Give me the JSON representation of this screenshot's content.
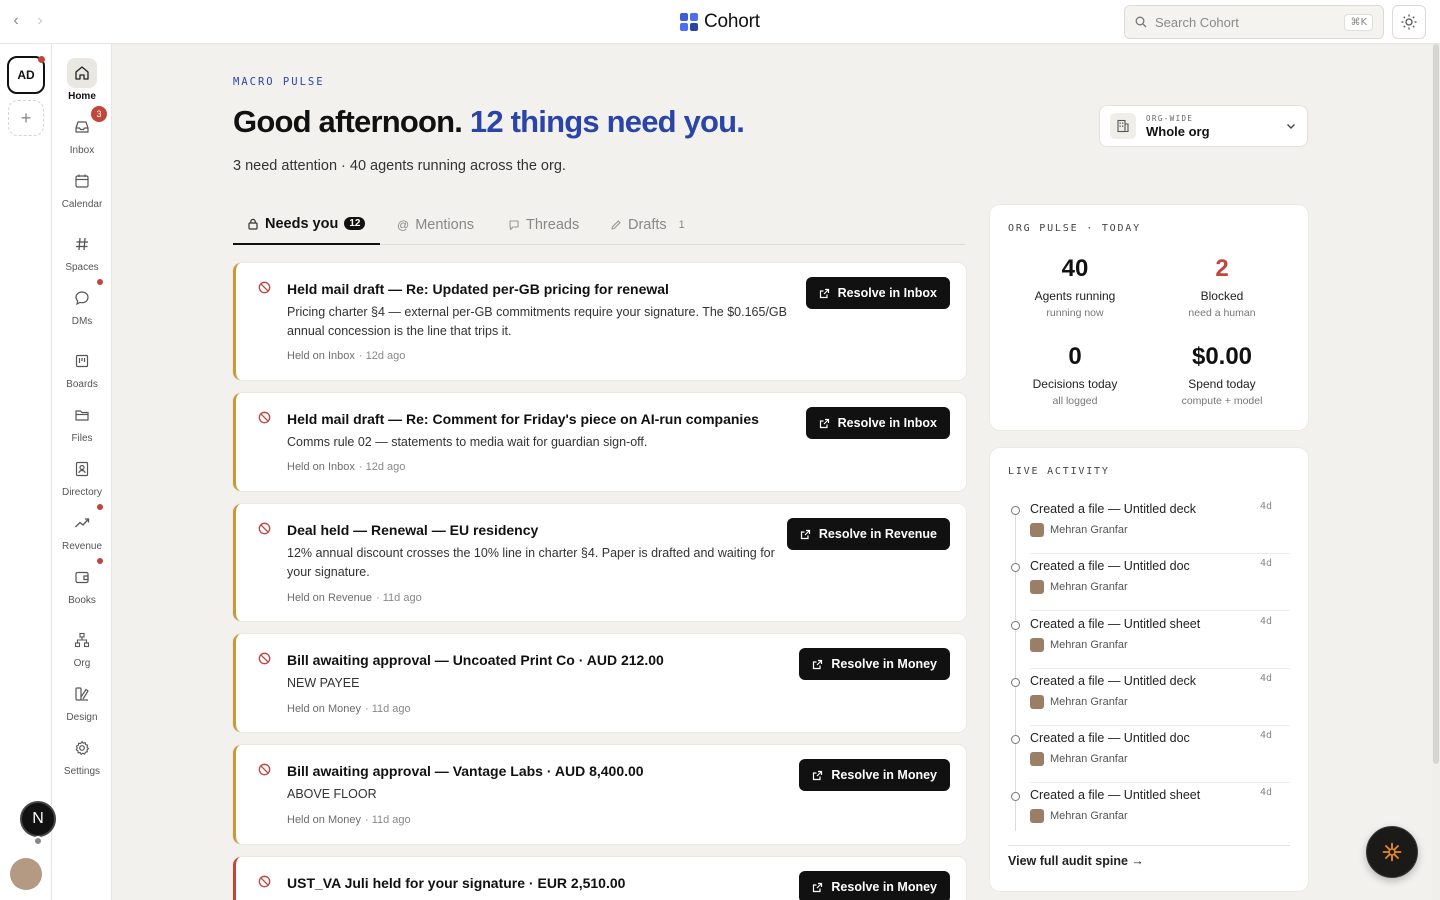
{
  "app": {
    "name": "Cohort",
    "brand_color": "#2a44a8"
  },
  "topbar": {
    "search_placeholder": "Search Cohort",
    "search_shortcut": "⌘K"
  },
  "org_rail": {
    "active_org": "AD",
    "add_icon": "plus-icon",
    "user_initial": "N"
  },
  "nav": {
    "items": [
      {
        "label": "Home",
        "icon": "home-icon",
        "active": true
      },
      {
        "label": "Inbox",
        "icon": "inbox-icon",
        "badge": "3"
      },
      {
        "label": "Calendar",
        "icon": "calendar-icon"
      },
      {
        "label": "Spaces",
        "icon": "hash-icon"
      },
      {
        "label": "DMs",
        "icon": "chat-icon",
        "dot": true
      },
      {
        "label": "Boards",
        "icon": "board-icon"
      },
      {
        "label": "Files",
        "icon": "folder-icon"
      },
      {
        "label": "Directory",
        "icon": "contact-icon"
      },
      {
        "label": "Revenue",
        "icon": "trend-icon",
        "dot": true
      },
      {
        "label": "Books",
        "icon": "wallet-icon",
        "dot": true
      },
      {
        "label": "Org",
        "icon": "org-chart-icon"
      },
      {
        "label": "Design",
        "icon": "design-icon"
      },
      {
        "label": "Settings",
        "icon": "gear-icon"
      }
    ]
  },
  "main": {
    "eyebrow": "MACRO PULSE",
    "headline_lead": "Good afternoon.",
    "headline_accent": "12 things need you.",
    "subline": "3 need attention · 40 agents running across the org.",
    "scope": {
      "label": "ORG-WIDE",
      "value": "Whole org"
    },
    "tabs": [
      {
        "label": "Needs you",
        "count": "12",
        "active": true
      },
      {
        "label": "Mentions"
      },
      {
        "label": "Threads"
      },
      {
        "label": "Drafts",
        "count": "1"
      }
    ],
    "cards": [
      {
        "title": "Held mail draft — Re: Updated per-GB pricing for renewal",
        "body": "Pricing charter §4 — external per-GB commitments require your signature. The $0.165/GB annual concession is the line that trips it.",
        "meta": "Held on Inbox",
        "age": "· 12d ago",
        "action": "Resolve in Inbox"
      },
      {
        "title": "Held mail draft — Re: Comment for Friday's piece on AI-run companies",
        "body": "Comms rule 02 — statements to media wait for guardian sign-off.",
        "meta": "Held on Inbox",
        "age": "· 12d ago",
        "action": "Resolve in Inbox"
      },
      {
        "title": "Deal held — Renewal — EU residency",
        "body": "12% annual discount crosses the 10% line in charter §4. Paper is drafted and waiting for your signature.",
        "meta": "Held on Revenue",
        "age": "· 11d ago",
        "action": "Resolve in Revenue"
      },
      {
        "title": "Bill awaiting approval — Uncoated Print Co · AUD 212.00",
        "body": "NEW PAYEE",
        "meta": "Held on Money",
        "age": "· 11d ago",
        "action": "Resolve in Money"
      },
      {
        "title": "Bill awaiting approval — Vantage Labs · AUD 8,400.00",
        "body": "ABOVE FLOOR",
        "meta": "Held on Money",
        "age": "· 11d ago",
        "action": "Resolve in Money"
      },
      {
        "title": "UST_VA Juli held for your signature · EUR 2,510.00",
        "body": "",
        "meta": "",
        "age": "",
        "action": "Resolve in Money"
      }
    ]
  },
  "pulse": {
    "title": "ORG PULSE · TODAY",
    "stats": [
      {
        "value": "40",
        "label": "Agents running",
        "sub": "running now"
      },
      {
        "value": "2",
        "label": "Blocked",
        "sub": "need a human",
        "alert": true
      },
      {
        "value": "0",
        "label": "Decisions today",
        "sub": "all logged"
      },
      {
        "value": "$0.00",
        "label": "Spend today",
        "sub": "compute + model"
      }
    ]
  },
  "activity": {
    "title": "LIVE ACTIVITY",
    "items": [
      {
        "text": "Created a file — Untitled deck",
        "who": "Mehran Granfar",
        "age": "4d"
      },
      {
        "text": "Created a file — Untitled doc",
        "who": "Mehran Granfar",
        "age": "4d"
      },
      {
        "text": "Created a file — Untitled sheet",
        "who": "Mehran Granfar",
        "age": "4d"
      },
      {
        "text": "Created a file — Untitled deck",
        "who": "Mehran Granfar",
        "age": "4d"
      },
      {
        "text": "Created a file — Untitled doc",
        "who": "Mehran Granfar",
        "age": "4d"
      },
      {
        "text": "Created a file — Untitled sheet",
        "who": "Mehran Granfar",
        "age": "4d"
      }
    ],
    "audit_link": "View full audit spine →"
  }
}
